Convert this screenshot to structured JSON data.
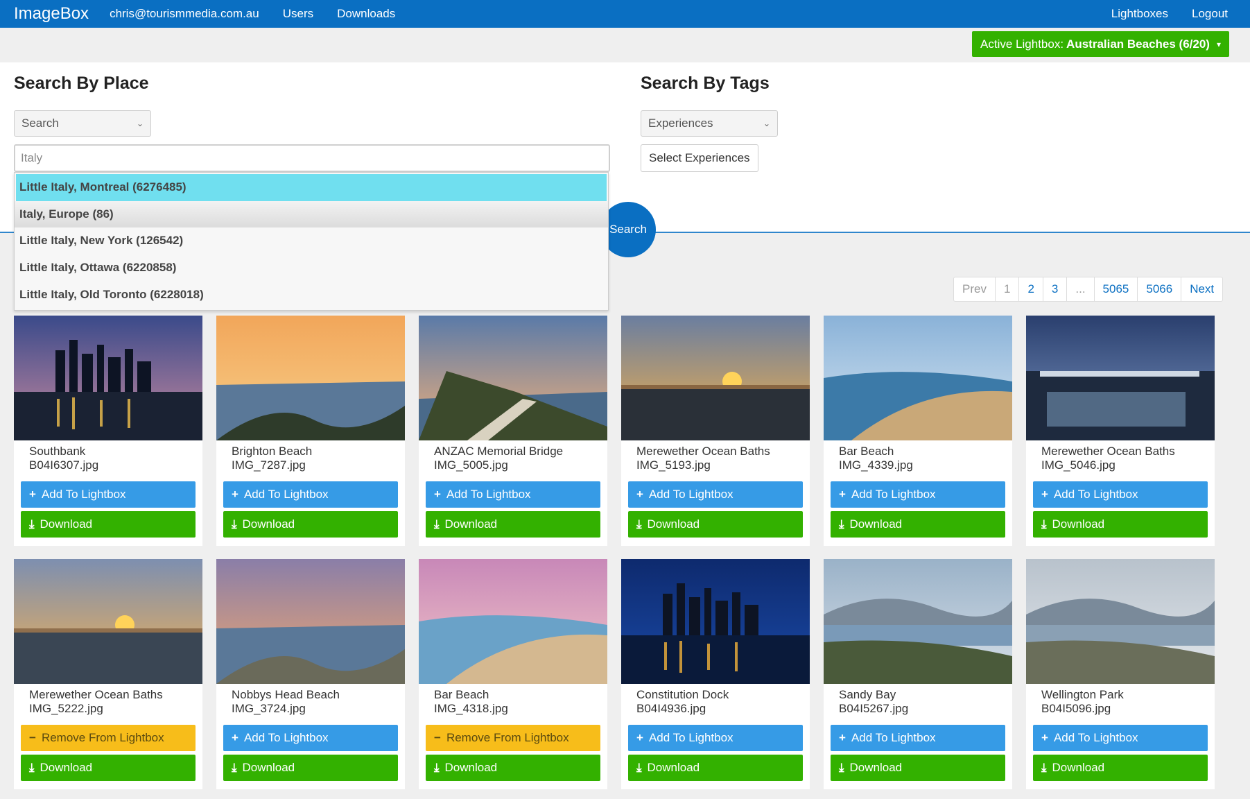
{
  "nav": {
    "brand": "ImageBox",
    "user": "chris@tourismmedia.com.au",
    "users": "Users",
    "downloads": "Downloads",
    "lightboxes": "Lightboxes",
    "logout": "Logout"
  },
  "active_lightbox": {
    "prefix": "Active Lightbox:",
    "name": "Australian Beaches (6/20)"
  },
  "search_place": {
    "title": "Search By Place",
    "select_value": "Search",
    "input_value": "Italy"
  },
  "search_tags": {
    "title": "Search By Tags",
    "select_value": "Experiences",
    "button_label": "Select Experiences"
  },
  "search_button": "Search",
  "dropdown": [
    "Little Italy, Montreal (6276485)",
    "Italy, Europe (86)",
    "Little Italy, New York (126542)",
    "Little Italy, Ottawa (6220858)",
    "Little Italy, Old Toronto (6228018)"
  ],
  "pagination": [
    "Prev",
    "1",
    "2",
    "3",
    "...",
    "5065",
    "5066",
    "Next"
  ],
  "labels": {
    "add": "Add To Lightbox",
    "remove": "Remove From Lightbox",
    "download": "Download"
  },
  "colors": {
    "nav": "#0a6fc2",
    "add": "#369be6",
    "remove": "#f7bd1a",
    "download": "#33b100",
    "dropdown_active": "#70dfef"
  },
  "cards": [
    {
      "title": "Southbank",
      "file": "B04I6307.jpg",
      "in_lightbox": false
    },
    {
      "title": "Brighton Beach",
      "file": "IMG_7287.jpg",
      "in_lightbox": false
    },
    {
      "title": "ANZAC Memorial Bridge",
      "file": "IMG_5005.jpg",
      "in_lightbox": false
    },
    {
      "title": "Merewether Ocean Baths",
      "file": "IMG_5193.jpg",
      "in_lightbox": false
    },
    {
      "title": "Bar Beach",
      "file": "IMG_4339.jpg",
      "in_lightbox": false
    },
    {
      "title": "Merewether Ocean Baths",
      "file": "IMG_5046.jpg",
      "in_lightbox": false
    },
    {
      "title": "Merewether Ocean Baths",
      "file": "IMG_5222.jpg",
      "in_lightbox": true
    },
    {
      "title": "Nobbys Head Beach",
      "file": "IMG_3724.jpg",
      "in_lightbox": false
    },
    {
      "title": "Bar Beach",
      "file": "IMG_4318.jpg",
      "in_lightbox": true
    },
    {
      "title": "Constitution Dock",
      "file": "B04I4936.jpg",
      "in_lightbox": false
    },
    {
      "title": "Sandy Bay",
      "file": "B04I5267.jpg",
      "in_lightbox": false
    },
    {
      "title": "Wellington Park",
      "file": "B04I5096.jpg",
      "in_lightbox": false
    }
  ]
}
